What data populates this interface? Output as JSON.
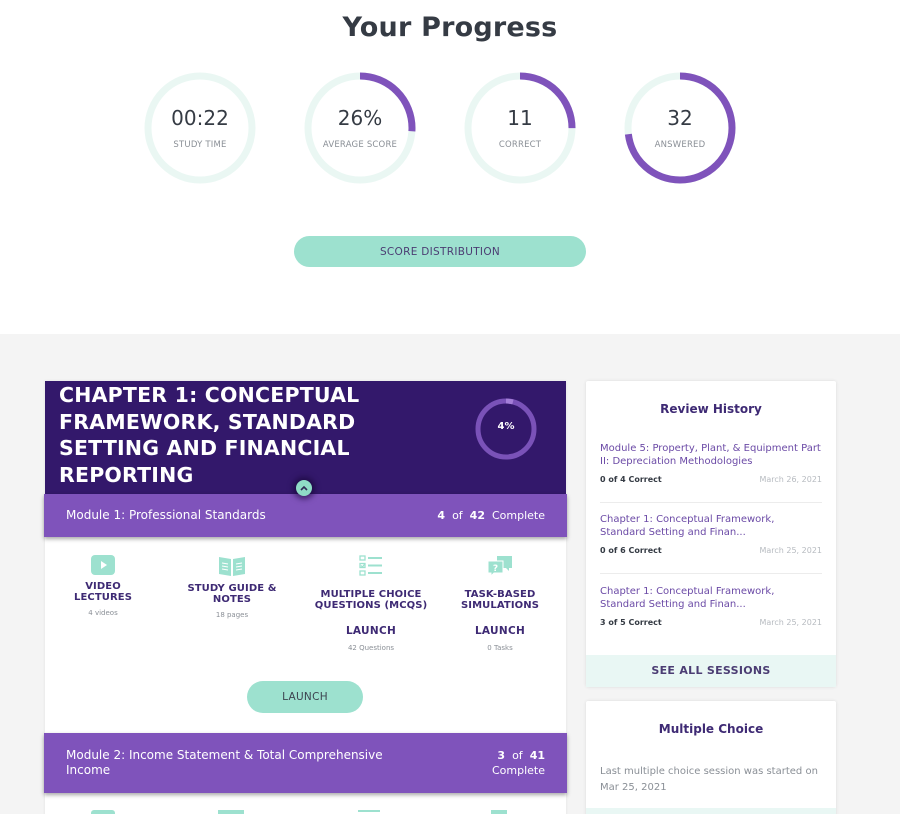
{
  "page": {
    "title": "Your Progress"
  },
  "colors": {
    "accent_purple": "#7f53bb",
    "dark_purple": "#33186b",
    "mint": "#9de1cf",
    "ring_track": "#eaf7f3",
    "text_purple": "#3e2a74"
  },
  "stats": [
    {
      "value": "00:22",
      "label": "STUDY TIME",
      "progress": 0
    },
    {
      "value": "26%",
      "label": "AVERAGE SCORE",
      "progress": 0.26
    },
    {
      "value": "11",
      "label": "CORRECT",
      "progress": 0.25
    },
    {
      "value": "32",
      "label": "ANSWERED",
      "progress": 0.73
    }
  ],
  "score_distribution_button": "SCORE DISTRIBUTION",
  "chapter": {
    "title": "CHAPTER 1: CONCEPTUAL FRAMEWORK, STANDARD SETTING AND FINANCIAL REPORTING",
    "progress_label": "4%",
    "progress": 0.04,
    "collapse_icon": "chevron-up-icon",
    "modules": [
      {
        "name": "Module 1: Professional Standards",
        "completed": "4",
        "of": "of",
        "total": "42",
        "complete_label": "Complete",
        "resources": [
          {
            "icon": "video-play-icon",
            "title_line1": "VIDEO",
            "title_line2": "LECTURES",
            "sub": "4 videos"
          },
          {
            "icon": "open-book-icon",
            "title_line1": "STUDY GUIDE &",
            "title_line2": "NOTES",
            "sub": "18 pages"
          },
          {
            "icon": "checklist-icon",
            "title_line1": "MULTIPLE CHOICE",
            "title_line2": "QUESTIONS (MCQS)",
            "launch": "LAUNCH",
            "sub": "42 Questions"
          },
          {
            "icon": "question-chat-icon",
            "title_line1": "TASK-BASED",
            "title_line2": "SIMULATIONS",
            "launch": "LAUNCH",
            "sub": "0 Tasks"
          }
        ],
        "launch_button": "LAUNCH"
      },
      {
        "name": "Module 2: Income Statement & Total Comprehensive Income",
        "completed": "3",
        "of": "of",
        "total": "41",
        "complete_label": "Complete"
      }
    ]
  },
  "review_history": {
    "title": "Review History",
    "items": [
      {
        "name": "Module 5: Property, Plant, & Equipment Part II: Depreciation Methodologies",
        "score": "0 of 4 Correct",
        "date": "March 26, 2021"
      },
      {
        "name": "Chapter 1: Conceptual Framework, Standard Setting and Finan...",
        "score": "0 of 6 Correct",
        "date": "March 25, 2021"
      },
      {
        "name": "Chapter 1: Conceptual Framework, Standard Setting and Finan...",
        "score": "3 of 5 Correct",
        "date": "March 25, 2021"
      }
    ],
    "see_all": "SEE ALL SESSIONS"
  },
  "multiple_choice": {
    "title": "Multiple Choice",
    "text": "Last multiple choice session was started on Mar 25, 2021"
  }
}
